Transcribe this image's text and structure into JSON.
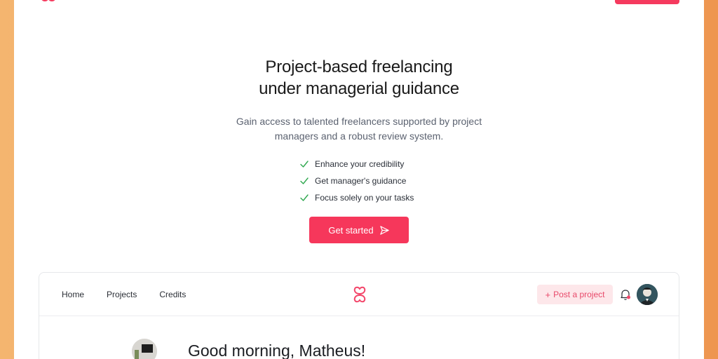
{
  "hero": {
    "title_line1": "Project-based freelancing",
    "title_line2": "under managerial guidance",
    "subtitle_line1": "Gain access to talented freelancers supported by project",
    "subtitle_line2": "managers and a robust review system.",
    "features": [
      "Enhance your credibility",
      "Get manager's guidance",
      "Focus solely on your tasks"
    ],
    "cta_label": "Get started"
  },
  "app_preview": {
    "nav_links": [
      "Home",
      "Projects",
      "Credits"
    ],
    "post_button_label": "Post a project",
    "greeting": "Good morning, Matheus!"
  },
  "colors": {
    "brand": "#f6375b",
    "check": "#2fa84f",
    "background_gradient_start": "#f4b56f",
    "background_gradient_end": "#ee9650"
  },
  "icons": [
    "clover-logo-icon",
    "check-icon",
    "send-icon",
    "plus-icon",
    "bell-icon",
    "avatar"
  ]
}
